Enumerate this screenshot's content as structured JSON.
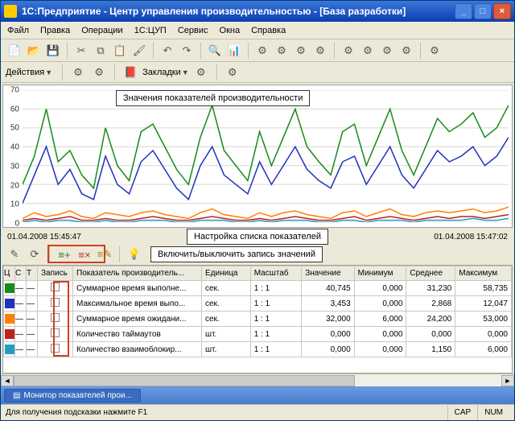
{
  "title": "1С:Предприятие - Центр управления производительностью - [База разработки]",
  "menu": [
    "Файл",
    "Правка",
    "Операции",
    "1С:ЦУП",
    "Сервис",
    "Окна",
    "Справка"
  ],
  "actions_label": "Действия",
  "bookmarks_label": "Закладки",
  "callouts": {
    "chart": "Значения показателей производительности",
    "list": "Настройка списка показателей",
    "toggle": "Включить/выключить запись значений"
  },
  "dates": {
    "left": "01.04.2008 15:45:47",
    "right": "01.04.2008 15:47:02"
  },
  "chart_data": {
    "type": "line",
    "ylim": [
      0,
      70
    ],
    "yticks": [
      0,
      10,
      20,
      30,
      40,
      50,
      60,
      70
    ],
    "series": [
      {
        "name": "Суммарное время выполнения",
        "color": "#1a8a1a",
        "values": [
          20,
          35,
          60,
          32,
          38,
          25,
          18,
          50,
          30,
          22,
          48,
          52,
          40,
          28,
          20,
          45,
          62,
          38,
          30,
          22,
          48,
          30,
          45,
          60,
          40,
          32,
          25,
          48,
          52,
          30,
          45,
          60,
          38,
          25,
          40,
          55,
          48,
          52,
          58,
          45,
          50,
          62
        ]
      },
      {
        "name": "Максимальное время выполнения",
        "color": "#2030c0",
        "values": [
          10,
          25,
          40,
          20,
          28,
          15,
          12,
          35,
          20,
          15,
          32,
          38,
          28,
          18,
          12,
          30,
          40,
          25,
          20,
          15,
          32,
          20,
          30,
          40,
          28,
          22,
          18,
          32,
          35,
          20,
          30,
          40,
          25,
          18,
          28,
          38,
          32,
          35,
          40,
          30,
          35,
          45
        ]
      },
      {
        "name": "Суммарное время ожидания",
        "color": "#ff8000",
        "values": [
          2,
          5,
          3,
          4,
          6,
          3,
          2,
          5,
          4,
          3,
          5,
          6,
          4,
          3,
          2,
          5,
          7,
          4,
          3,
          2,
          5,
          3,
          5,
          6,
          4,
          3,
          2,
          5,
          6,
          3,
          5,
          7,
          4,
          3,
          5,
          6,
          5,
          6,
          7,
          5,
          6,
          8
        ]
      },
      {
        "name": "Количество таймаутов",
        "color": "#c02020",
        "values": [
          1,
          2,
          1,
          2,
          3,
          1,
          1,
          2,
          1,
          1,
          2,
          3,
          2,
          1,
          1,
          2,
          3,
          2,
          1,
          1,
          2,
          1,
          2,
          3,
          2,
          1,
          1,
          2,
          3,
          1,
          2,
          3,
          2,
          1,
          2,
          3,
          2,
          3,
          3,
          2,
          3,
          4
        ]
      },
      {
        "name": "Количество взаимоблокировок",
        "color": "#20a0c0",
        "values": [
          0,
          1,
          0,
          1,
          1,
          0,
          0,
          1,
          0,
          0,
          1,
          1,
          1,
          0,
          0,
          1,
          1,
          1,
          0,
          0,
          1,
          0,
          1,
          1,
          1,
          0,
          0,
          1,
          1,
          0,
          1,
          1,
          1,
          0,
          1,
          1,
          1,
          1,
          2,
          1,
          1,
          2
        ]
      }
    ]
  },
  "columns": [
    "Ц",
    "С",
    "Т",
    "Запись",
    "Показатель производитель...",
    "Единица",
    "Масштаб",
    "Значение",
    "Минимум",
    "Среднее",
    "Максимум"
  ],
  "rows": [
    {
      "color": "#1a8a1a",
      "name": "Суммарное время выполне...",
      "unit": "сек.",
      "scale": "1 : 1",
      "val": "40,745",
      "min": "0,000",
      "avg": "31,230",
      "max": "58,735"
    },
    {
      "color": "#2030c0",
      "name": "Максимальное время выпо...",
      "unit": "сек.",
      "scale": "1 : 1",
      "val": "3,453",
      "min": "0,000",
      "avg": "2,868",
      "max": "12,047"
    },
    {
      "color": "#ff8000",
      "name": "Суммарное время ожидани...",
      "unit": "сек.",
      "scale": "1 : 1",
      "val": "32,000",
      "min": "6,000",
      "avg": "24,200",
      "max": "53,000"
    },
    {
      "color": "#c02020",
      "name": "Количество таймаутов",
      "unit": "шт.",
      "scale": "1 : 1",
      "val": "0,000",
      "min": "0,000",
      "avg": "0,000",
      "max": "0,000"
    },
    {
      "color": "#20a0c0",
      "name": "Количество взаимоблокир...",
      "unit": "шт.",
      "scale": "1 : 1",
      "val": "0,000",
      "min": "0,000",
      "avg": "1,150",
      "max": "6,000"
    }
  ],
  "task": "Монитор показателей прои...",
  "status": {
    "hint": "Для получения подсказки нажмите F1",
    "cap": "CAP",
    "num": "NUM"
  }
}
